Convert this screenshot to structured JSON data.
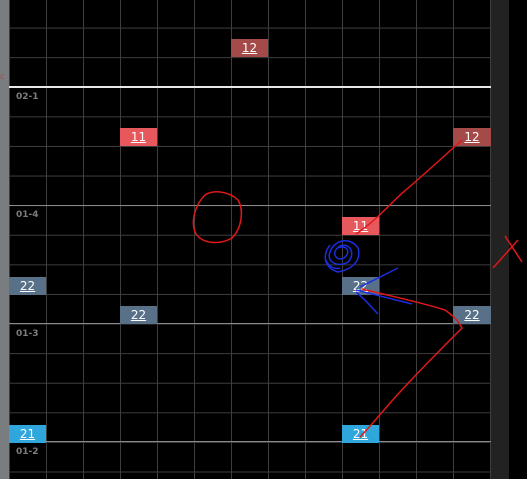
{
  "row_labels": {
    "r1": "02-1",
    "r2": "01-4",
    "r3": "01-3",
    "r4": "01-2"
  },
  "blocks": {
    "b1": "12",
    "b2": "11",
    "b3": "12",
    "b4": "11",
    "b5": "22",
    "b6": "22",
    "b7": "22",
    "b8": "22",
    "b9": "21",
    "b10": "21"
  },
  "colors": {
    "block_dark_red": "#a44a48",
    "block_red": "#e6585c",
    "block_slate": "#587088",
    "block_cyan": "#2fa6dc",
    "ink_red": "#e01818",
    "ink_blue": "#1a2de0"
  }
}
